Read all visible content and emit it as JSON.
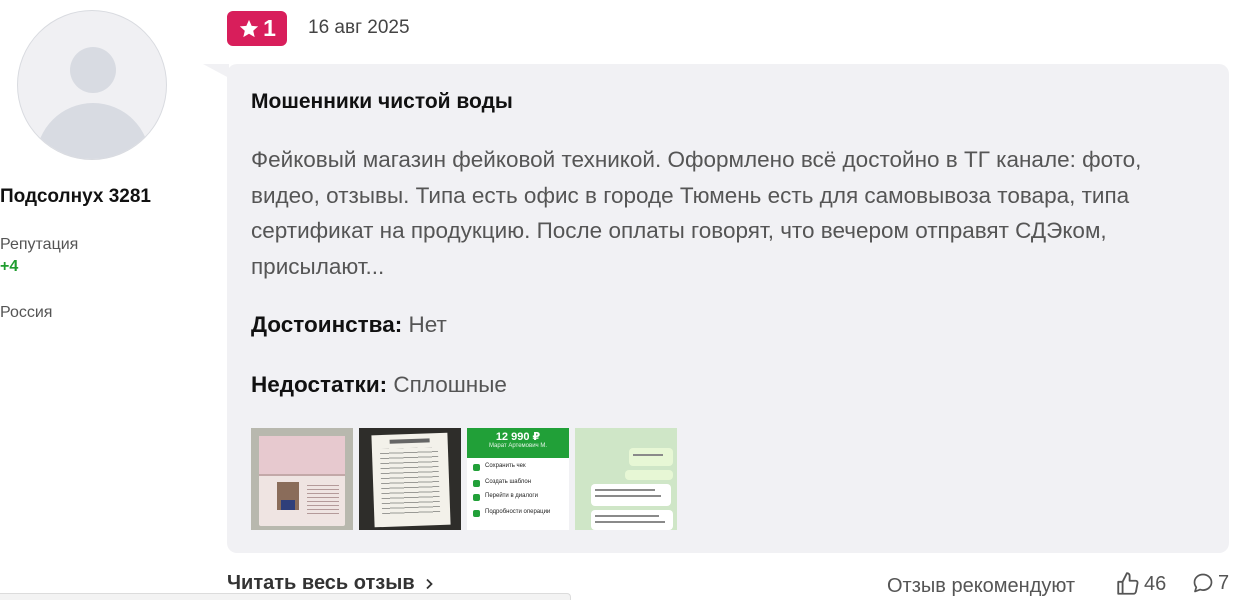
{
  "author": {
    "name": "Подсолнух 3281",
    "reputation_label": "Репутация",
    "reputation_value": "+4",
    "country": "Россия",
    "avatar_icon": "user-placeholder-icon"
  },
  "review": {
    "rating": "1",
    "rating_color": "#d81e5b",
    "date": "16 авг 2025",
    "title": "Мошенники чистой воды",
    "text": "Фейковый магазин фейковой техникой. Оформлено всё достойно в ТГ канале: фото, видео, отзывы. Типа есть офис в городе Тюмень есть для самовывоза товара, типа сертификат на продукцию. После оплаты говорят, что вечером отправят СДЭком, присылают...",
    "pros_label": "Достоинства:",
    "pros_value": "Нет",
    "cons_label": "Недостатки:",
    "cons_value": "Сплошные",
    "thumbnails": [
      {
        "name": "passport-photo"
      },
      {
        "name": "certificate-photo"
      },
      {
        "name": "payment-screenshot",
        "amount": "12 990 ₽",
        "recipient": "Марат Артемович М.",
        "rows": [
          "Сохранить чек",
          "Создать шаблон",
          "Перейти в диалоги",
          "Подробности операции"
        ]
      },
      {
        "name": "chat-screenshot"
      }
    ]
  },
  "footer": {
    "read_more": "Читать весь отзыв",
    "recommend_label": "Отзыв рекомендуют",
    "likes": "46",
    "comments": "7"
  }
}
